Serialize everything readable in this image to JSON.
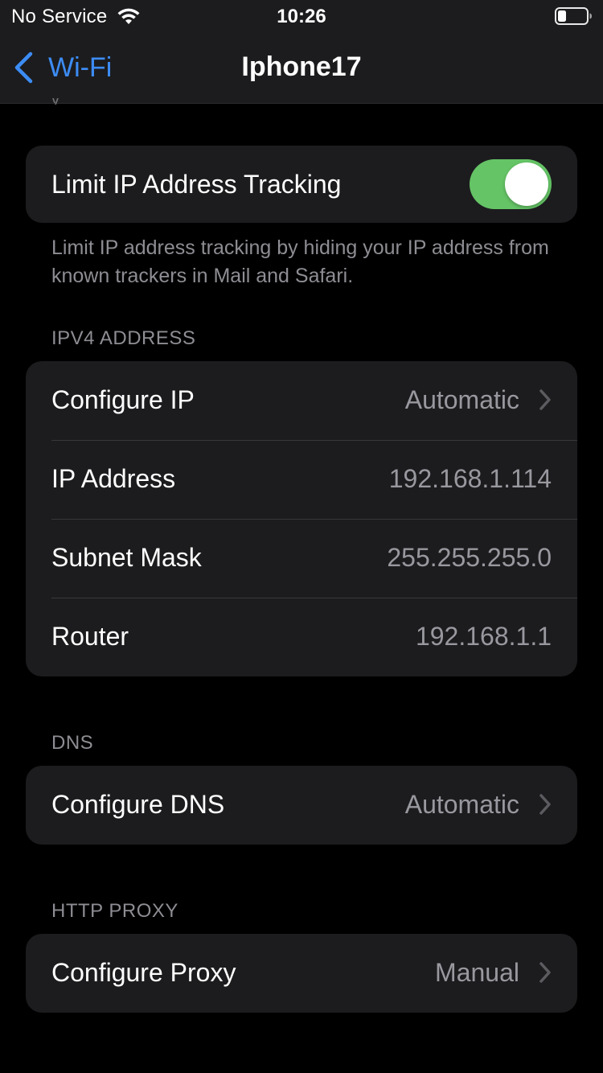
{
  "status_bar": {
    "carrier": "No Service",
    "time": "10:26",
    "wifi_icon": "wifi-icon",
    "battery_icon": "battery-icon"
  },
  "nav": {
    "back_label": "Wi-Fi",
    "title": "Iphone17",
    "back_icon": "chevron-left-icon"
  },
  "limit_tracking": {
    "label": "Limit IP Address Tracking",
    "enabled": true,
    "footer": "Limit IP address tracking by hiding your IP address from known trackers in Mail and Safari."
  },
  "ipv4": {
    "header": "IPV4 ADDRESS",
    "rows": [
      {
        "label": "Configure IP",
        "value": "Automatic"
      },
      {
        "label": "IP Address",
        "value": "192.168.1.114"
      },
      {
        "label": "Subnet Mask",
        "value": "255.255.255.0"
      },
      {
        "label": "Router",
        "value": "192.168.1.1"
      }
    ]
  },
  "dns": {
    "header": "DNS",
    "rows": [
      {
        "label": "Configure DNS",
        "value": "Automatic"
      }
    ]
  },
  "http_proxy": {
    "header": "HTTP PROXY",
    "rows": [
      {
        "label": "Configure Proxy",
        "value": "Manual"
      }
    ]
  },
  "colors": {
    "accent": "#3d8cf5",
    "toggle_on": "#65c466",
    "background": "#000000",
    "cell": "#1c1c1e",
    "secondary_text": "#98989f"
  }
}
